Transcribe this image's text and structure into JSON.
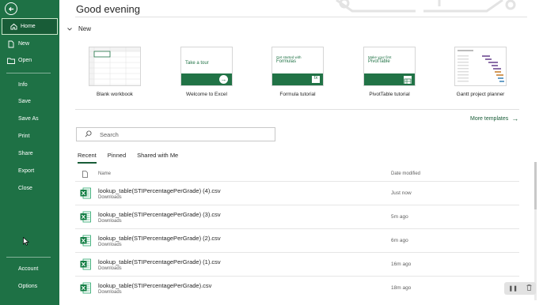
{
  "sidebar": {
    "items": [
      {
        "label": "Home"
      },
      {
        "label": "New"
      },
      {
        "label": "Open"
      },
      {
        "label": "Info"
      },
      {
        "label": "Save"
      },
      {
        "label": "Save As"
      },
      {
        "label": "Print"
      },
      {
        "label": "Share"
      },
      {
        "label": "Export"
      },
      {
        "label": "Close"
      },
      {
        "label": "Account"
      },
      {
        "label": "Options"
      }
    ],
    "active": "Home",
    "color": "#1e7145"
  },
  "main": {
    "greeting": "Good evening",
    "new_section": "New",
    "templates": [
      {
        "label": "Blank workbook"
      },
      {
        "label": "Welcome to Excel",
        "thumb_text": "Take a tour"
      },
      {
        "label": "Formula tutorial",
        "thumb_text_small": "Get started with",
        "thumb_text": "Formulas"
      },
      {
        "label": "PivotTable tutorial",
        "thumb_text_small": "Make your first",
        "thumb_text": "PivotTable"
      },
      {
        "label": "Gantt project planner"
      }
    ],
    "more_templates": "More templates",
    "search_placeholder": "Search",
    "tabs": [
      "Recent",
      "Pinned",
      "Shared with Me"
    ],
    "active_tab": "Recent",
    "columns": {
      "name": "Name",
      "date": "Date modified"
    },
    "files": [
      {
        "name": "lookup_table(STIPercentagePerGrade) (4).csv",
        "location": "Downloads",
        "date": "Just now"
      },
      {
        "name": "lookup_table(STIPercentagePerGrade) (3).csv",
        "location": "Downloads",
        "date": "5m ago"
      },
      {
        "name": "lookup_table(STIPercentagePerGrade) (2).csv",
        "location": "Downloads",
        "date": "6m ago"
      },
      {
        "name": "lookup_table(STIPercentagePerGrade) (1).csv",
        "location": "Downloads",
        "date": "16m ago"
      },
      {
        "name": "lookup_table(STIPercentagePerGrade).csv",
        "location": "Downloads",
        "date": "18m ago"
      }
    ]
  },
  "accent": "#185c37"
}
